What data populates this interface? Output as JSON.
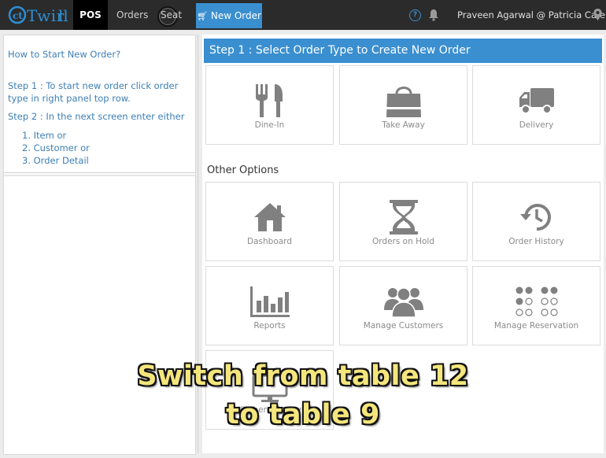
{
  "topbar": {
    "logo_text": "Twir",
    "tabs": {
      "pos": "POS",
      "orders": "Orders",
      "seat": "Seat"
    },
    "new_order": "New Order",
    "user": "Praveen Agarwal @ Patricia Cafe"
  },
  "help": {
    "title": "How to Start New Order?",
    "step1": [
      "Step 1 : To start new order click order",
      "type in right panel top row."
    ],
    "step2": "Step 2 : In the next screen enter either",
    "options": [
      "1. Item or",
      "2. Customer or",
      "3. Order Detail"
    ]
  },
  "main": {
    "step_header": "Step 1 : Select Order Type to Create New Order",
    "order_types": [
      "Dine-In",
      "Take Away",
      "Delivery"
    ],
    "other_title": "Other Options",
    "other_options": [
      "Dashboard",
      "Orders on Hold",
      "Order History",
      "Reports",
      "Manage Customers",
      "Manage Reservation",
      "Kitchen Display"
    ]
  },
  "caption": {
    "line1": "Switch from table 12",
    "line2": "to table 9"
  },
  "colors": {
    "accent": "#3a8fd0",
    "topbar": "#2b2b2b",
    "icon": "#808080",
    "caption": "#f4e67c"
  }
}
